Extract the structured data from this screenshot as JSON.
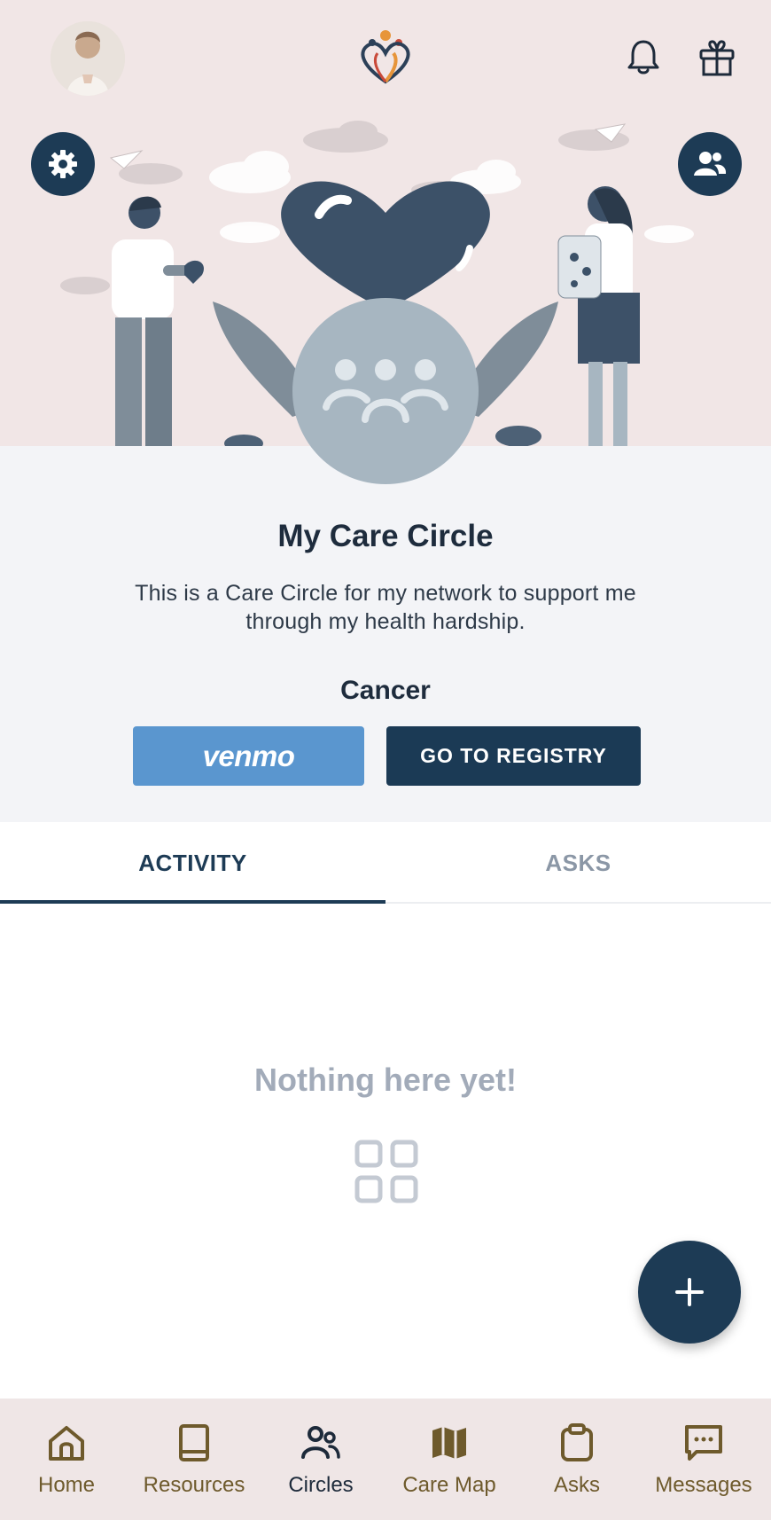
{
  "header": {
    "avatar_icon": "user-avatar-photo",
    "logo_icon": "heart-people-logo",
    "notifications_icon": "bell-icon",
    "gift_icon": "gift-icon"
  },
  "hero": {
    "settings_icon": "gear-icon",
    "members_icon": "people-icon"
  },
  "circle": {
    "title": "My Care Circle",
    "description": "This is a Care Circle for my network to support me through my health hardship.",
    "category": "Cancer",
    "venmo_label": "venmo",
    "registry_label": "GO TO REGISTRY"
  },
  "tabs": [
    {
      "label": "ACTIVITY",
      "active": true
    },
    {
      "label": "ASKS",
      "active": false
    }
  ],
  "empty_state": {
    "message": "Nothing here yet!"
  },
  "fab": {
    "icon": "plus-icon"
  },
  "bottom_nav": [
    {
      "label": "Home",
      "icon": "home-icon",
      "active": false
    },
    {
      "label": "Resources",
      "icon": "book-icon",
      "active": false
    },
    {
      "label": "Circles",
      "icon": "people-icon",
      "active": true
    },
    {
      "label": "Care Map",
      "icon": "map-icon",
      "active": false
    },
    {
      "label": "Asks",
      "icon": "clipboard-icon",
      "active": false
    },
    {
      "label": "Messages",
      "icon": "message-icon",
      "active": false
    }
  ],
  "colors": {
    "primary": "#1d3b55",
    "venmo": "#5a96cf",
    "hero_bg": "#f1e6e6",
    "nav_label": "#6e5a2c",
    "muted": "#a2abb9"
  }
}
